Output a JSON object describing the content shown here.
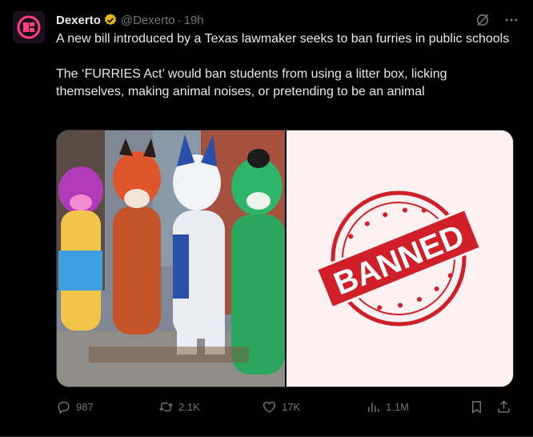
{
  "author": {
    "name": "Dexerto",
    "handle": "@Dexerto",
    "time": "19h",
    "separator": "·"
  },
  "tweet": {
    "text": "A new bill introduced by a Texas lawmaker seeks to ban furries in public schools\n\nThe ‘FURRIES Act’ would ban students from using a litter box, licking themselves, making animal noises, or pretending to be an animal"
  },
  "media": {
    "stamp_text": "BANNED"
  },
  "stats": {
    "replies": "987",
    "reposts": "2.1K",
    "likes": "17K",
    "views": "1.1M"
  },
  "colors": {
    "background": "#000000",
    "text": "#e7e9ea",
    "muted": "#71767b",
    "verified": "#e2b719",
    "stamp": "#d11f2a"
  },
  "icons": {
    "grok": "grok-icon",
    "more": "more-icon",
    "reply": "reply-icon",
    "repost": "repost-icon",
    "like": "heart-icon",
    "views": "views-icon",
    "bookmark": "bookmark-icon",
    "share": "share-icon"
  }
}
